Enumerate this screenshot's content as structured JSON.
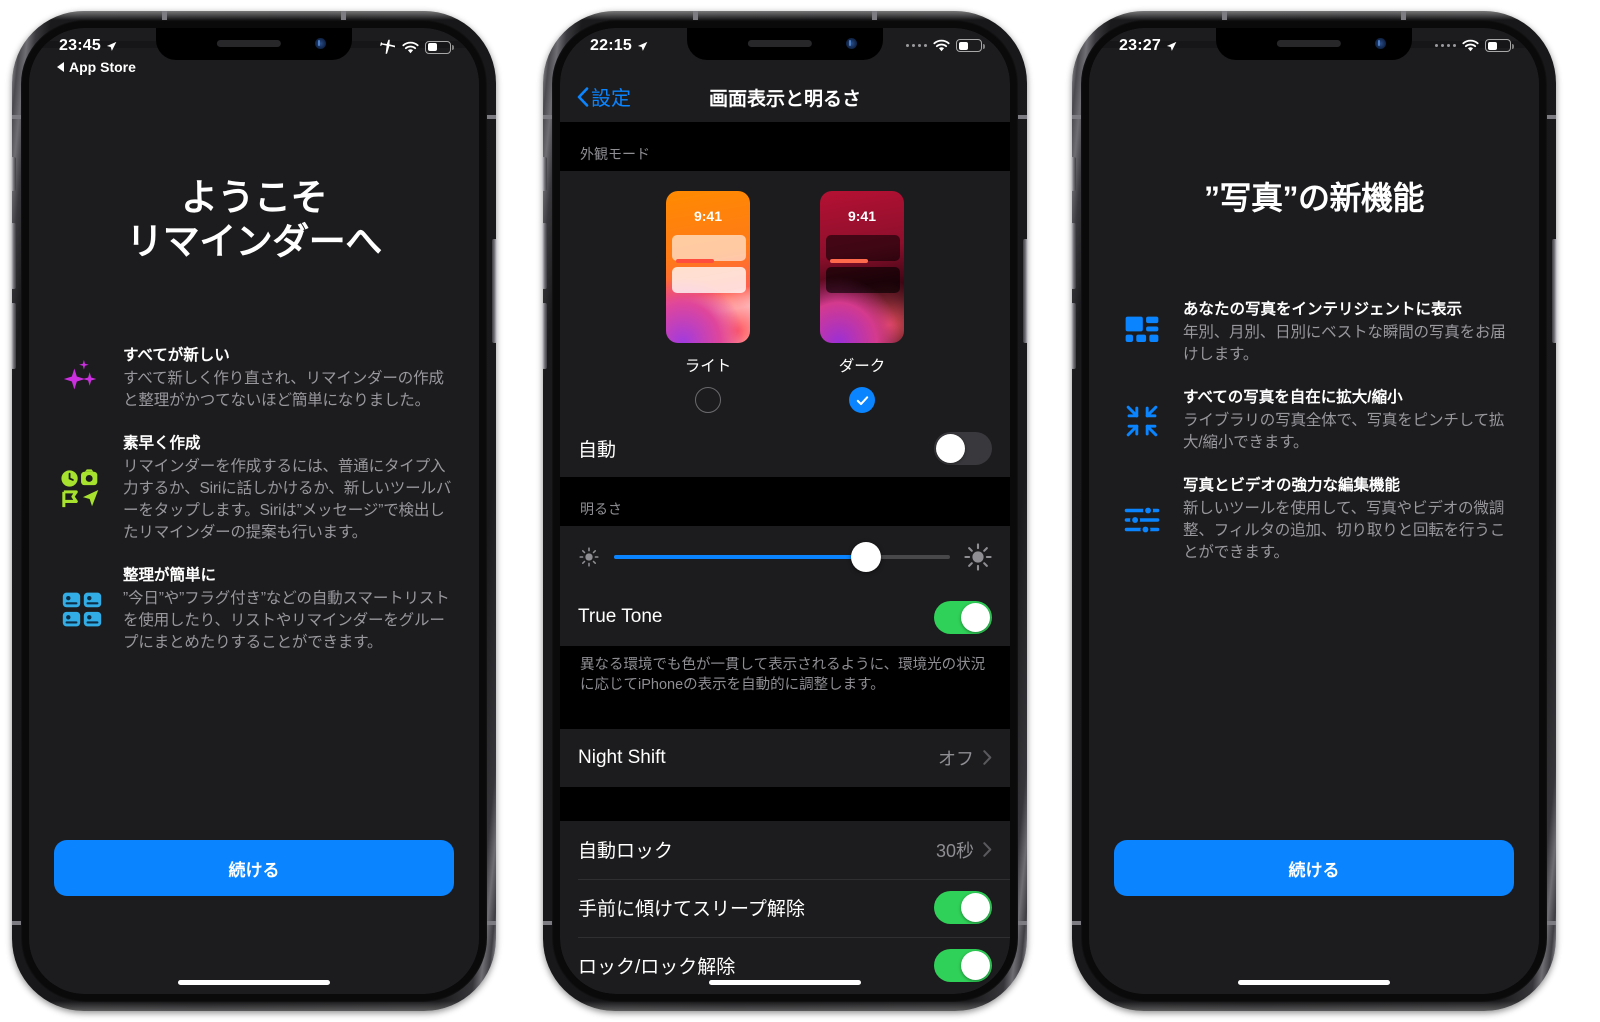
{
  "phone1": {
    "statusbar": {
      "time": "23:45",
      "back_label": "App Store",
      "icons": [
        "location-arrow",
        "airplane-mode",
        "wifi",
        "battery"
      ]
    },
    "title": "ようこそ\nリマインダーへ",
    "features": [
      {
        "icon": "sparkles-icon",
        "color": "#cc2fe0",
        "heading": "すべてが新しい",
        "body": "すべて新しく作り直され、リマインダーの作成と整理がかつてないほど簡単になりました。"
      },
      {
        "icon": "quick-create-icon",
        "color": "#a6e22e",
        "heading": "素早く作成",
        "body": "リマインダーを作成するには、普通にタイプ入力するか、Siriに話しかけるか、新しいツールバーをタップします。Siriは”メッセージ”で検出したリマインダーの提案も行います。"
      },
      {
        "icon": "smart-lists-grid-icon",
        "color": "#32ade6",
        "heading": "整理が簡単に",
        "body": "”今日”や”フラグ付き”などの自動スマートリストを使用したり、リストやリマインダーをグループにまとめたりすることができます。"
      }
    ],
    "cta_label": "続ける"
  },
  "phone2": {
    "statusbar": {
      "time": "22:15",
      "icons": [
        "location-arrow",
        "cellular-dots",
        "wifi",
        "battery"
      ]
    },
    "nav": {
      "back_label": "設定",
      "title": "画面表示と明るさ"
    },
    "appearance": {
      "group_header": "外観モード",
      "themes": [
        {
          "label": "ライト",
          "thumb_time": "9:41",
          "selected": false
        },
        {
          "label": "ダーク",
          "thumb_time": "9:41",
          "selected": true
        }
      ],
      "auto_row": {
        "label": "自動",
        "toggle_on": false
      }
    },
    "brightness": {
      "group_header": "明るさ",
      "slider": {
        "value_percent": 75,
        "low_icon": "sun-small-icon",
        "high_icon": "sun-large-icon"
      },
      "true_tone": {
        "label": "True Tone",
        "toggle_on": true
      },
      "note": "異なる環境でも色が一貫して表示されるように、環境光の状況に応じてiPhoneの表示を自動的に調整します。"
    },
    "night_shift": {
      "label": "Night Shift",
      "value": "オフ"
    },
    "lock_section": [
      {
        "label": "自動ロック",
        "value": "30秒",
        "type": "disclosure"
      },
      {
        "label": "手前に傾けてスリープ解除",
        "type": "toggle",
        "toggle_on": true
      },
      {
        "label": "ロック/ロック解除",
        "type": "toggle",
        "toggle_on": true
      }
    ],
    "accent_color": "#0a84ff",
    "toggle_on_color": "#30d158"
  },
  "phone3": {
    "statusbar": {
      "time": "23:27",
      "icons": [
        "location-arrow",
        "cellular-dots",
        "wifi",
        "battery"
      ]
    },
    "title": "”写真”の新機能",
    "features": [
      {
        "icon": "photos-grid-icon",
        "color": "#0a84ff",
        "heading": "あなたの写真をインテリジェントに表示",
        "body": "年別、月別、日別にベストな瞬間の写真をお届けします。"
      },
      {
        "icon": "zoom-expand-icon",
        "color": "#0a84ff",
        "heading": "すべての写真を自在に拡大/縮小",
        "body": "ライブラリの写真全体で、写真をピンチして拡大/縮小できます。"
      },
      {
        "icon": "edit-sliders-icon",
        "color": "#0a84ff",
        "heading": "写真とビデオの強力な編集機能",
        "body": "新しいツールを使用して、写真やビデオの微調整、フィルタの追加、切り取りと回転を行うことができます。"
      }
    ],
    "cta_label": "続ける"
  }
}
